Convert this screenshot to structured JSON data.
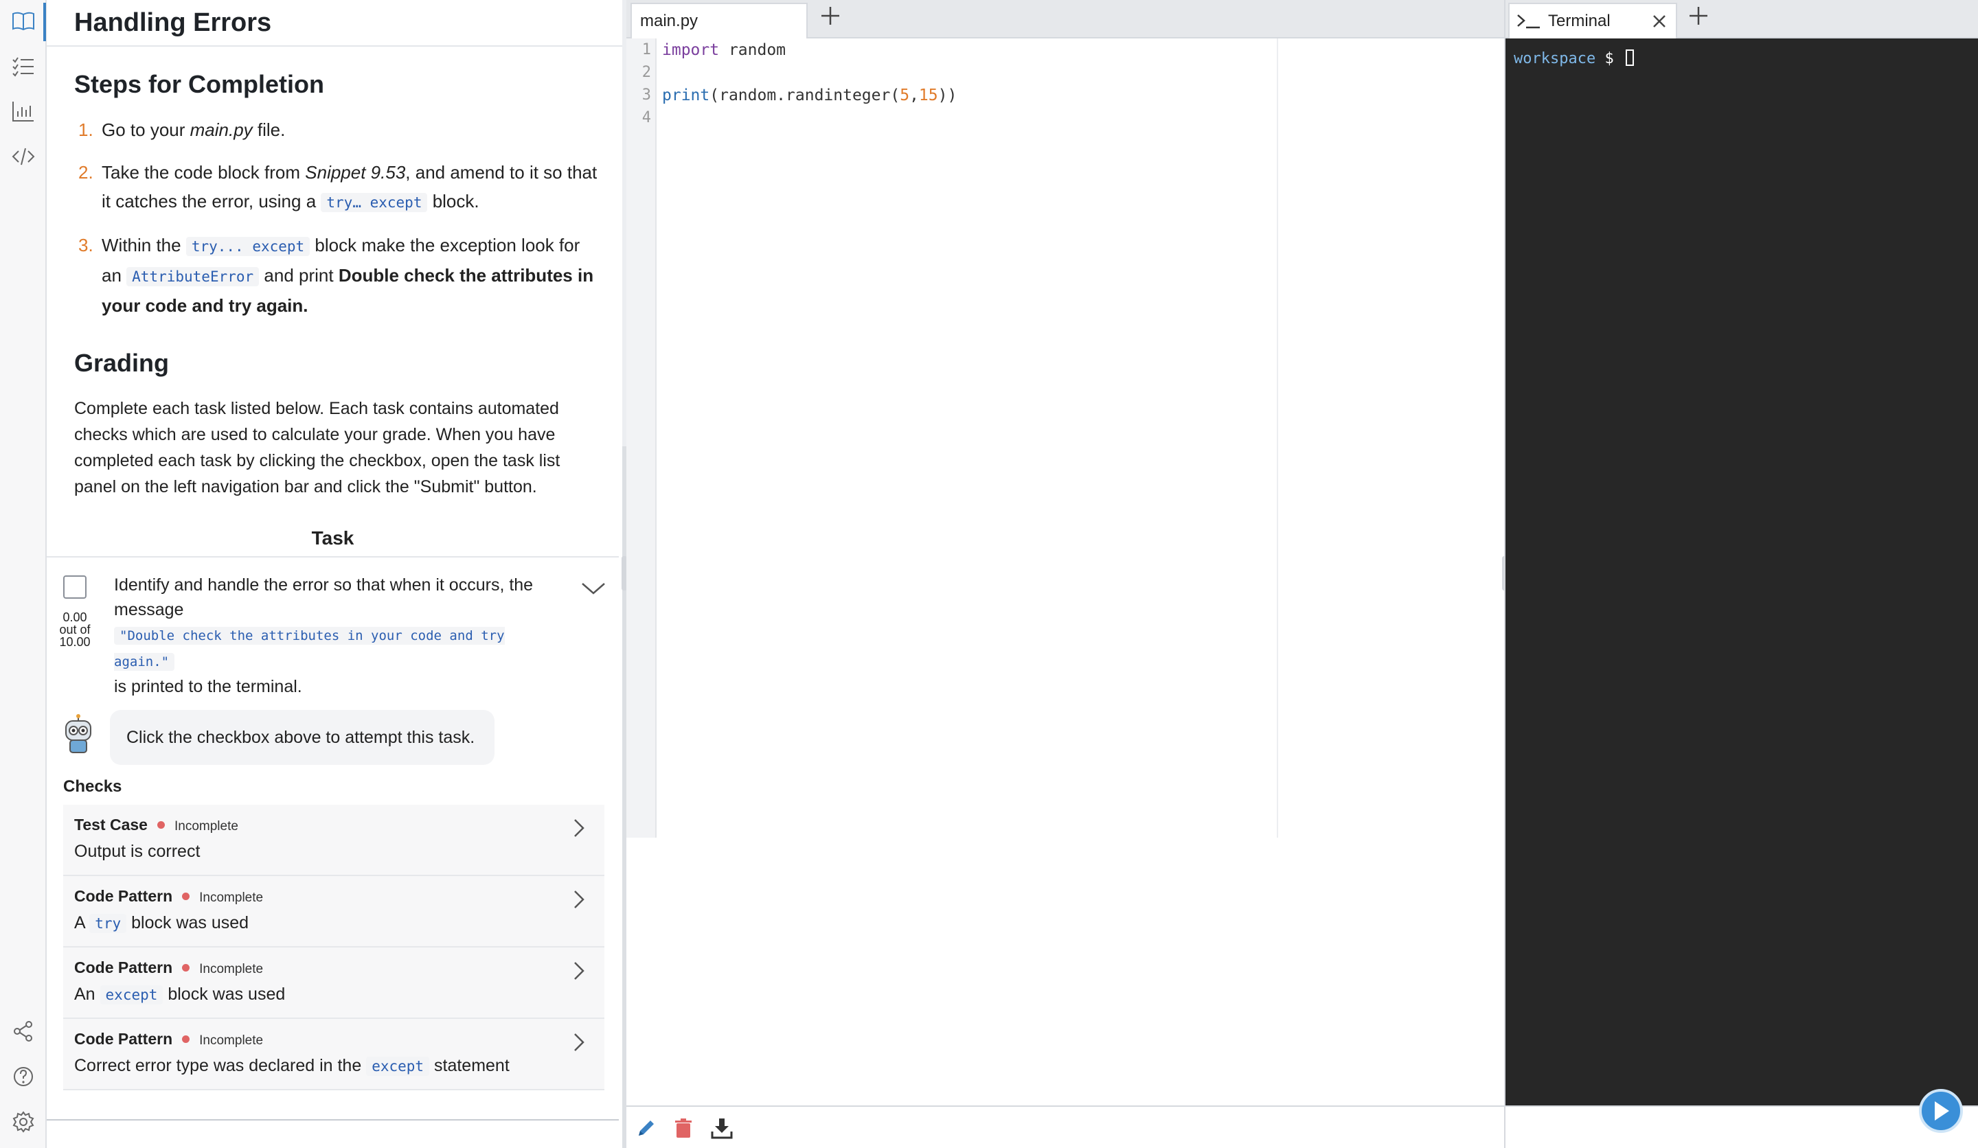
{
  "guide": {
    "title": "Handling Errors",
    "steps_heading": "Steps for Completion",
    "steps": [
      {
        "num": "1.",
        "pre": "Go to your ",
        "em": "main.py",
        "post": " file."
      },
      {
        "num": "2.",
        "pre": "Take the code block from ",
        "em": "Snippet 9.53",
        "mid": ", and amend to it so that it catches the error, using a ",
        "code": "try… except",
        "post": " block."
      },
      {
        "num": "3.",
        "pre": "Within the ",
        "code": "try... except",
        "mid": " block make the exception look for an ",
        "code2": "AttributeError",
        "mid2": " and print ",
        "bold": "Double check the attributes in your code and try again."
      }
    ],
    "grading_heading": "Grading",
    "grading_text": "Complete each task listed below. Each task contains automated checks which are used to calculate your grade. When you have completed each task by clicking the checkbox, open the task list panel on the left navigation bar and click the \"Submit\" button.",
    "task_header": "Task",
    "task": {
      "score": "0.00",
      "score_out_of": "out of",
      "score_max": "10.00",
      "text_pre": "Identify and handle the error so that when it occurs, the message",
      "code": "\"Double check the attributes in your code and try again.\"",
      "text_post": "is printed to the terminal.",
      "hint": "Click the checkbox above to attempt this task."
    },
    "checks_label": "Checks",
    "checks": [
      {
        "type": "Test Case",
        "status": "Incomplete",
        "pre": "Output is correct",
        "code": "",
        "post": ""
      },
      {
        "type": "Code Pattern",
        "status": "Incomplete",
        "pre": "A ",
        "code": "try",
        "post": " block was used"
      },
      {
        "type": "Code Pattern",
        "status": "Incomplete",
        "pre": "An ",
        "code": "except",
        "post": " block was used"
      },
      {
        "type": "Code Pattern",
        "status": "Incomplete",
        "pre": "Correct error type was declared in the ",
        "code": "except",
        "post": " statement"
      }
    ]
  },
  "rail": {
    "icons": [
      "book-icon",
      "task-list-icon",
      "bar-chart-icon",
      "code-icon",
      "share-icon",
      "help-icon",
      "settings-icon"
    ]
  },
  "editor": {
    "tab_label": "main.py",
    "line_numbers": [
      "1",
      "2",
      "3",
      "4"
    ],
    "code": {
      "line1_kw": "import",
      "line1_rest": " random",
      "line3_fn": "print",
      "line3_a": "(random.randinteger(",
      "line3_n1": "5",
      "line3_comma": ",",
      "line3_n2": "15",
      "line3_close": "))"
    },
    "bottom_tools": [
      "pencil-icon",
      "trash-icon",
      "download-icon"
    ]
  },
  "terminal": {
    "tab_label": "Terminal",
    "prompt_dir": "workspace",
    "prompt_symbol": " $ "
  },
  "colors": {
    "accent": "#3b82c4",
    "incomplete_dot": "#e06464",
    "terminal_bg": "#272727",
    "keyword": "#7a3e9d",
    "number": "#e07b2a"
  }
}
